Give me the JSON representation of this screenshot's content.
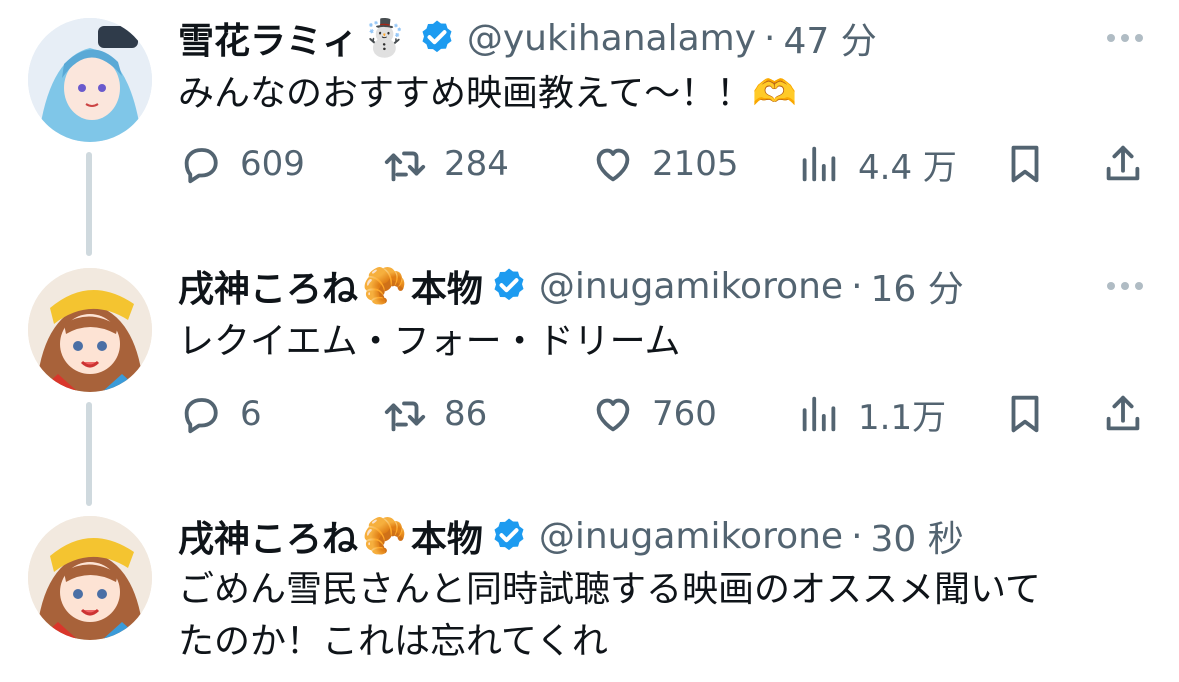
{
  "tweets": [
    {
      "name": "雪花ラミィ",
      "name_emoji": "☃️",
      "handle": "@yukihanalamy",
      "dot": "·",
      "time": "47 分",
      "text": [
        "みんなのおすすめ映画教えて〜！！🫶"
      ],
      "replies": "609",
      "retweets": "284",
      "likes": "2105",
      "views": "4.4 万"
    },
    {
      "name": "戌神ころね",
      "name_emoji": "🥐",
      "name_suffix": "本物",
      "handle": "@inugamikorone",
      "dot": "·",
      "time": "16 分",
      "text": [
        "レクイエム・フォー・ドリーム"
      ],
      "replies": "6",
      "retweets": "86",
      "likes": "760",
      "views": "1.1万"
    },
    {
      "name": "戌神ころね",
      "name_emoji": "🥐",
      "name_suffix": "本物",
      "handle": "@inugamikorone",
      "dot": "·",
      "time": "30 秒",
      "text": [
        "ごめん雪民さんと同時試聴する映画のオススメ聞いて",
        "たのか！これは忘れてくれ"
      ]
    }
  ],
  "colors": {
    "verified": "#1d9bf0",
    "secondary_text": "#536471",
    "thread_line": "#cfd9de",
    "lamy_hair": "#7fc6e8",
    "korone_hair": "#a8623a",
    "korone_hat": "#f4c430"
  },
  "icons": [
    "reply-icon",
    "retweet-icon",
    "like-icon",
    "views-icon",
    "bookmark-icon",
    "share-icon",
    "more-icon",
    "verified-badge-icon"
  ]
}
